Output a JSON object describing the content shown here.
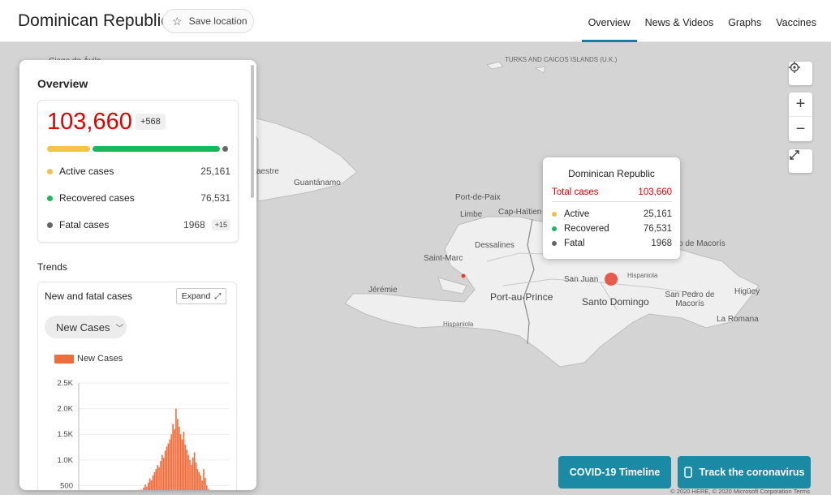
{
  "header": {
    "title": "Dominican Republic",
    "save_label": "Save location",
    "tabs": [
      {
        "label": "Overview",
        "active": true
      },
      {
        "label": "News & Videos",
        "active": false
      },
      {
        "label": "Graphs",
        "active": false
      },
      {
        "label": "Vaccines",
        "active": false
      }
    ]
  },
  "panel": {
    "title": "Overview",
    "total": "103,660",
    "total_delta": "+568",
    "stats": [
      {
        "label": "Active cases",
        "value": "25,161",
        "color": "#f7c14b"
      },
      {
        "label": "Recovered cases",
        "value": "76,531",
        "color": "#1ab85a"
      },
      {
        "label": "Fatal cases",
        "value": "1968",
        "color": "#666666",
        "delta": "+15"
      }
    ],
    "trends_label": "Trends",
    "trend_card": {
      "title": "New and fatal cases",
      "expand_label": "Expand",
      "select_value": "New Cases",
      "legend_label": "New Cases"
    }
  },
  "chart_data": {
    "type": "bar",
    "series": [
      {
        "name": "New Cases",
        "color": "#f26b3a"
      }
    ],
    "y_ticks": [
      "2.5K",
      "2.0K",
      "1.5K",
      "1.0K",
      "500"
    ],
    "ylim": [
      0,
      2500
    ],
    "values": [
      40,
      60,
      30,
      80,
      50,
      20,
      70,
      120,
      60,
      90,
      140,
      110,
      80,
      160,
      190,
      130,
      210,
      170,
      250,
      300,
      220,
      280,
      340,
      310,
      420,
      380,
      460,
      520,
      480,
      560,
      640,
      600,
      700,
      760,
      820,
      900,
      860,
      980,
      1100,
      1040,
      1180,
      1260,
      1320,
      1400,
      1500,
      1700,
      1600,
      2000,
      1800,
      1650,
      1500,
      1400,
      1550,
      1300,
      1200,
      1100,
      1000,
      900,
      1050,
      1150,
      950,
      820,
      760,
      700,
      600,
      820,
      650,
      500,
      430,
      380,
      330,
      300,
      350,
      260,
      220,
      180,
      150
    ]
  },
  "tooltip": {
    "title": "Dominican Republic",
    "total_label": "Total cases",
    "total_value": "103,660",
    "rows": [
      {
        "label": "Active",
        "value": "25,161",
        "color": "#f7c14b"
      },
      {
        "label": "Recovered",
        "value": "76,531",
        "color": "#1ab85a"
      },
      {
        "label": "Fatal",
        "value": "1968",
        "color": "#666666"
      }
    ]
  },
  "map": {
    "labels": {
      "turks": "TURKS AND CAICOS ISLANDS (U.K.)",
      "guantanamo": "Guantánamo",
      "aestre": "aestre",
      "port_de_paix": "Port-de-Paix",
      "limbe": "Limbe",
      "cap_haitien": "Cap-Haïtien",
      "dessalines": "Dessalines",
      "saint_marc": "Saint-Marc",
      "jeremie": "Jérémie",
      "port_au_prince": "Port-au-Prince",
      "hispaniola_w": "Hispaniola",
      "san_juan": "San Juan",
      "hispaniola_e": "Hispaniola",
      "santo_domingo": "Santo Domingo",
      "san_pedro": "San Pedro de Macorís",
      "higuey": "Higüey",
      "la_romana": "La Romana",
      "macoris": "o de Macorís",
      "ciego": "Ciego de Ávila"
    }
  },
  "buttons": {
    "timeline": "COVID-19 Timeline",
    "track": "Track the coronavirus"
  },
  "copyright": "© 2020 HERE, © 2020 Microsoft Corporation  Terms"
}
